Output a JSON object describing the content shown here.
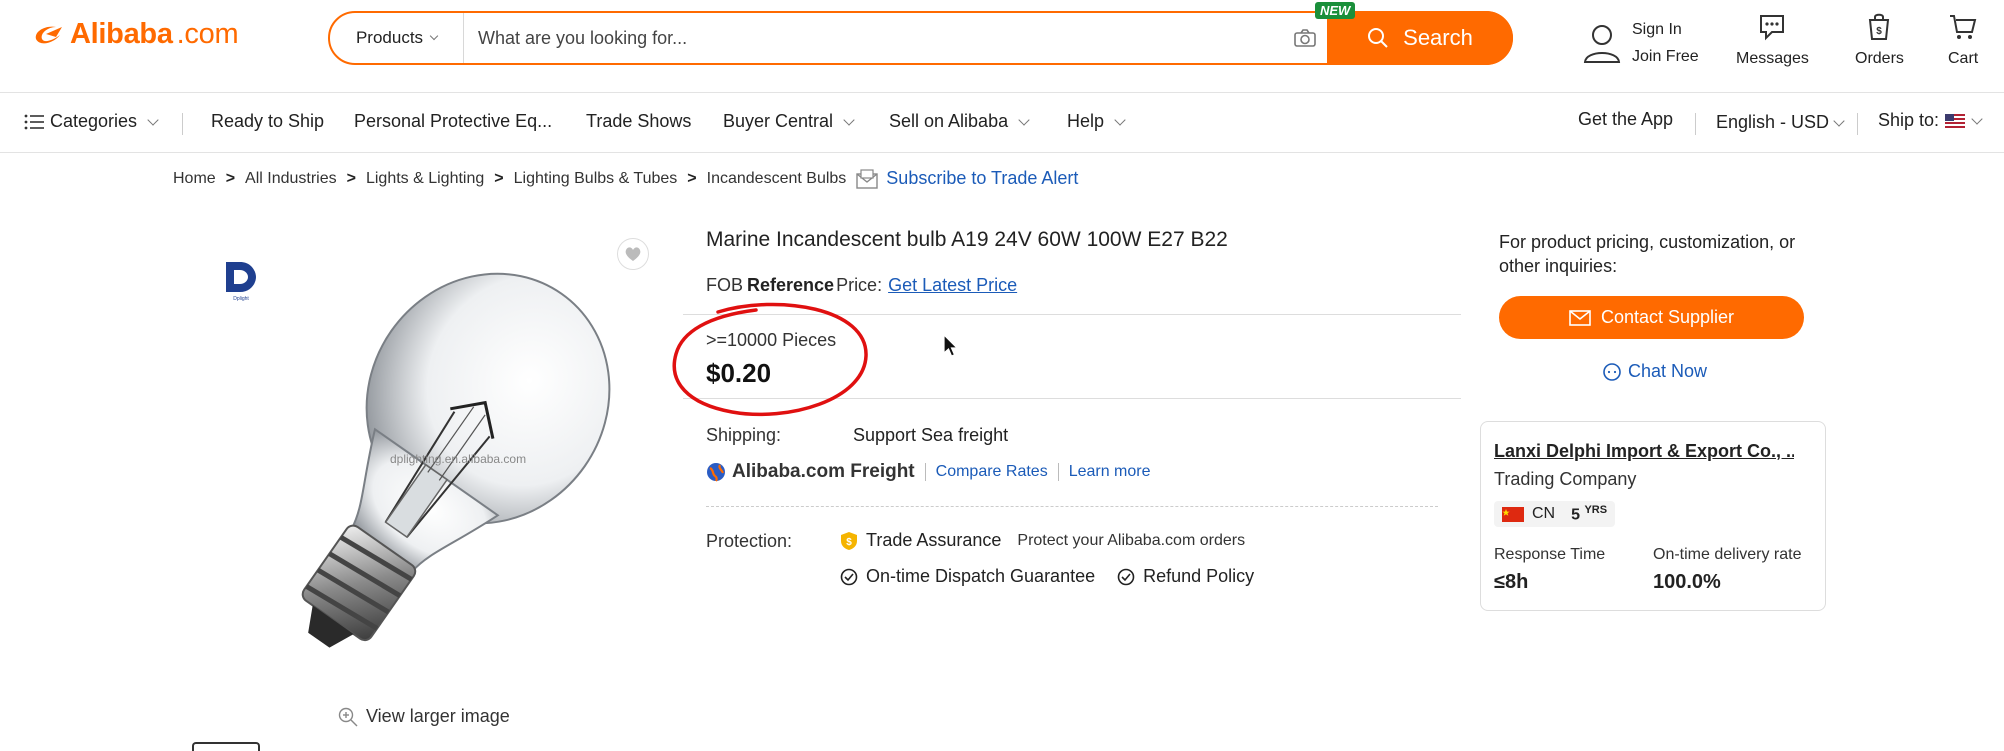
{
  "header": {
    "logo_text": "Alibaba",
    "logo_suffix": ".com",
    "search_category": "Products",
    "search_placeholder": "What are you looking for...",
    "new_badge": "NEW",
    "search_button": "Search",
    "sign_in": "Sign In",
    "join_free": "Join Free",
    "messages": "Messages",
    "orders": "Orders",
    "cart": "Cart"
  },
  "nav": {
    "categories": "Categories",
    "items": [
      "Ready to Ship",
      "Personal Protective Eq...",
      "Trade Shows",
      "Buyer Central",
      "Sell on Alibaba",
      "Help"
    ],
    "get_app": "Get the App",
    "language": "English - USD",
    "ship_to": "Ship to:"
  },
  "breadcrumb": {
    "items": [
      "Home",
      "All Industries",
      "Lights & Lighting",
      "Lighting Bulbs & Tubes",
      "Incandescent Bulbs"
    ],
    "separator": ">",
    "subscribe": "Subscribe to Trade Alert"
  },
  "product": {
    "title": "Marine Incandescent bulb A19 24V 60W 100W E27 B22",
    "fob_prefix": "FOB",
    "fob_reference": "Reference",
    "fob_price_label": "Price:",
    "get_latest_price": "Get Latest Price",
    "moq": ">=10000 Pieces",
    "price": "$0.20",
    "watermark": "dplighting.en.alibaba.com",
    "view_larger": "View larger image",
    "shipping_label": "Shipping:",
    "shipping_value": "Support Sea freight",
    "freight_brand": "Alibaba.com Freight",
    "compare_rates": "Compare Rates",
    "learn_more": "Learn more",
    "protection_label": "Protection:",
    "trade_assurance": "Trade Assurance",
    "trade_assurance_desc": "Protect your Alibaba.com orders",
    "dispatch_guarantee": "On-time Dispatch Guarantee",
    "refund_policy": "Refund Policy"
  },
  "supplier": {
    "inquiry_text": "For product pricing, customization, or other inquiries:",
    "contact_button": "Contact Supplier",
    "chat_now": "Chat Now",
    "name": "Lanxi Delphi Import & Export Co., ...",
    "type": "Trading Company",
    "country": "CN",
    "years": "5",
    "years_unit": "YRS",
    "response_time_label": "Response Time",
    "response_time_value": "≤8h",
    "delivery_rate_label": "On-time delivery rate",
    "delivery_rate_value": "100.0%"
  },
  "colors": {
    "brand_orange": "#ff6a00",
    "link_blue": "#1b5bb8",
    "annotation_red": "#e01010",
    "new_badge_green": "#1a8f3a"
  }
}
